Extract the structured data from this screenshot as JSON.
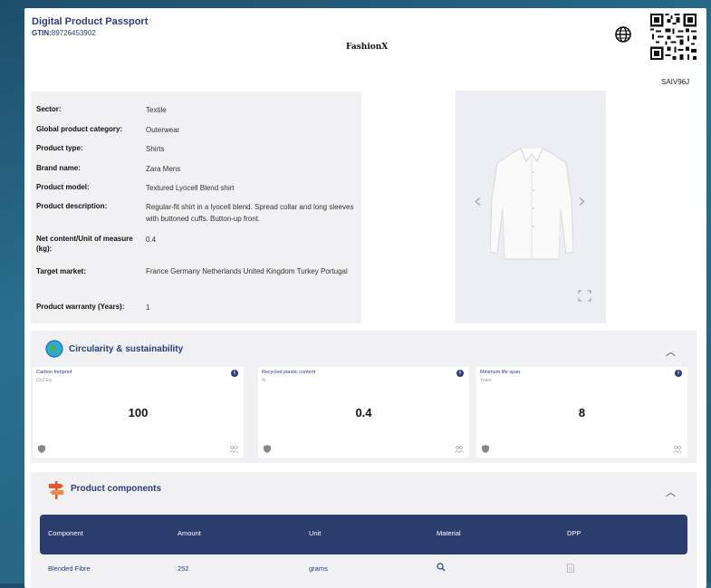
{
  "header": {
    "title": "Digital Product Passport",
    "gtin_label": "GTIN:",
    "gtin_value": "89726453902",
    "brand": "FashionX",
    "qr_code_label": "SAIV96J"
  },
  "product_info": [
    {
      "label": "Sector:",
      "value": "Textile"
    },
    {
      "label": "Global product category:",
      "value": "Outerwear"
    },
    {
      "label": "Product type:",
      "value": "Shirts"
    },
    {
      "label": "Brand name:",
      "value": "Zara Mens"
    },
    {
      "label": "Product model:",
      "value": "Textured Lyocell Blend shirt"
    },
    {
      "label": "Product description:",
      "value": "Regular-fit shirt in a lyocell blend. Spread collar and long sleeves with buttoned cuffs. Button-up front."
    },
    {
      "label": "Net content/Unit of measure (kg):",
      "value": "0.4"
    },
    {
      "label": "Target market:",
      "value": "France  Germany  Netherlands  United Kingdom  Turkey  Portugal"
    },
    {
      "label": "Product warranty (Years):",
      "value": "1"
    }
  ],
  "circularity": {
    "title": "Circularity & sustainability",
    "cards": [
      {
        "title": "Carbon footprint",
        "unit": "Co2 Eq.",
        "value": "100"
      },
      {
        "title": "Recycled plastic content",
        "unit": "%",
        "value": "0.4"
      },
      {
        "title": "Minimum life span",
        "unit": "Years",
        "value": "8"
      }
    ]
  },
  "components": {
    "title": "Product components",
    "columns": [
      "Component",
      "Amount",
      "Unit",
      "Material",
      "DPP"
    ],
    "rows": [
      {
        "component": "Blended Fibre",
        "amount": "252",
        "unit": "grams"
      }
    ]
  },
  "icons": {
    "globe": "globe-icon",
    "qr": "qr-code-icon",
    "prev": "chevron-left-icon",
    "next": "chevron-right-icon",
    "expand": "fullscreen-icon",
    "info": "info-icon",
    "shield": "shield-icon",
    "people": "people-icon",
    "search": "search-icon",
    "document": "document-icon",
    "collapse": "chevron-up-icon",
    "recycle": "recycle-globe-icon",
    "signpost": "signpost-icon"
  },
  "colors": {
    "accent": "#2b3d7a",
    "table_header": "#2b3d6c",
    "section_bg": "#f1f1f3",
    "signpost": "#e8552b"
  }
}
